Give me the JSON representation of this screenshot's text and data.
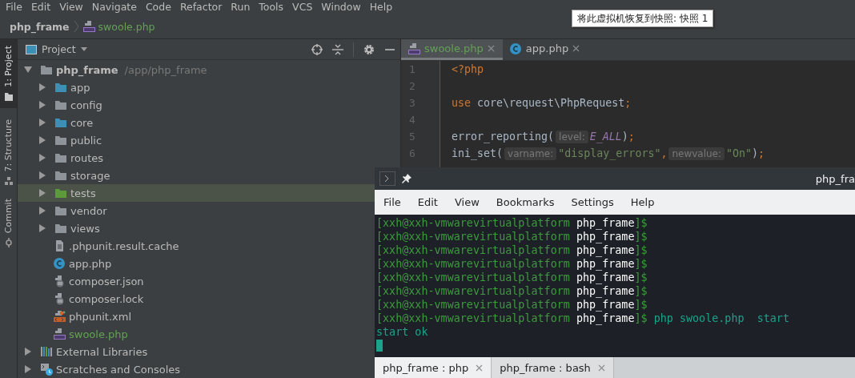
{
  "menu_bar": [
    "File",
    "Edit",
    "View",
    "Navigate",
    "Code",
    "Refactor",
    "Run",
    "Tools",
    "VCS",
    "Window",
    "Help"
  ],
  "breadcrumb": {
    "project": "php_frame",
    "file": "swoole.php"
  },
  "tooltip": "将此虚拟机恢复到快照: 快照 1",
  "tool_stripe": [
    {
      "label": "1: Project",
      "kind": "project",
      "selected": true
    },
    {
      "label": "7: Structure",
      "kind": "structure",
      "selected": false
    },
    {
      "label": "Commit",
      "kind": "commit",
      "selected": false
    }
  ],
  "project_panel": {
    "title": "Project",
    "tree": [
      {
        "name": "php_frame",
        "path": "/app/php_frame",
        "kind": "folder",
        "color": "#8e9499",
        "expanded": true,
        "selected": false,
        "added": false,
        "children": [
          {
            "name": "app",
            "kind": "folder",
            "color": "#3d8fb5",
            "expanded": false,
            "selected": false,
            "added": false
          },
          {
            "name": "config",
            "kind": "folder",
            "color": "#8e9499",
            "expanded": false,
            "selected": false,
            "added": false
          },
          {
            "name": "core",
            "kind": "folder",
            "color": "#3d8fb5",
            "expanded": false,
            "selected": false,
            "added": false
          },
          {
            "name": "public",
            "kind": "folder",
            "color": "#8e9499",
            "expanded": false,
            "selected": false,
            "added": false
          },
          {
            "name": "routes",
            "kind": "folder",
            "color": "#8e9499",
            "expanded": false,
            "selected": false,
            "added": false
          },
          {
            "name": "storage",
            "kind": "folder",
            "color": "#8e9499",
            "expanded": false,
            "selected": false,
            "added": false
          },
          {
            "name": "tests",
            "kind": "folder",
            "color": "#5d9a3c",
            "expanded": false,
            "selected": true,
            "added": false
          },
          {
            "name": "vendor",
            "kind": "folder",
            "color": "#8e9499",
            "expanded": false,
            "selected": false,
            "added": false
          },
          {
            "name": "views",
            "kind": "folder",
            "color": "#8e9499",
            "expanded": false,
            "selected": false,
            "added": false
          },
          {
            "name": ".phpunit.result.cache",
            "kind": "text-file",
            "selected": false,
            "added": false
          },
          {
            "name": "app.php",
            "kind": "class-file",
            "selected": false,
            "added": false
          },
          {
            "name": "composer.json",
            "kind": "composer-file",
            "selected": false,
            "added": false
          },
          {
            "name": "composer.lock",
            "kind": "composer-file",
            "selected": false,
            "added": false
          },
          {
            "name": "phpunit.xml",
            "kind": "xml-file",
            "selected": false,
            "added": false
          },
          {
            "name": "swoole.php",
            "kind": "php-file",
            "selected": false,
            "added": true
          }
        ]
      },
      {
        "name": "External Libraries",
        "kind": "libraries",
        "expanded": false,
        "selected": false,
        "added": false
      },
      {
        "name": "Scratches and Consoles",
        "kind": "scratches",
        "expanded": false,
        "selected": false,
        "added": false
      }
    ]
  },
  "editor": {
    "tabs": [
      {
        "label": "swoole.php",
        "kind": "php-file",
        "selected": true,
        "added": true
      },
      {
        "label": "app.php",
        "kind": "class-file",
        "selected": false,
        "added": false
      }
    ],
    "lines": [
      {
        "number": "1",
        "tokens": [
          {
            "kind": "keyword",
            "text": "<?php"
          }
        ]
      },
      {
        "number": "2"
      },
      {
        "number": "3",
        "tokens": [
          {
            "kind": "keyword",
            "text": "use"
          },
          {
            "kind": "plain",
            "text": " core\\request\\PhpRequest"
          },
          {
            "kind": "keyword",
            "text": ";"
          }
        ]
      },
      {
        "number": "4"
      },
      {
        "number": "5",
        "tokens": [
          {
            "kind": "plain",
            "text": "error_reporting("
          },
          {
            "kind": "hint",
            "text": "level:"
          },
          {
            "kind": "constant",
            "text": "E_ALL"
          },
          {
            "kind": "plain",
            "text": ")"
          },
          {
            "kind": "keyword",
            "text": ";"
          }
        ]
      },
      {
        "number": "6",
        "tokens": [
          {
            "kind": "plain",
            "text": "ini_set("
          },
          {
            "kind": "hint",
            "text": "varname:"
          },
          {
            "kind": "string",
            "text": "\"display_errors\""
          },
          {
            "kind": "keyword",
            "text": ","
          },
          {
            "kind": "hint",
            "text": "newvalue:"
          },
          {
            "kind": "string",
            "text": "\"On\""
          },
          {
            "kind": "plain",
            "text": ")"
          },
          {
            "kind": "keyword",
            "text": ";"
          }
        ]
      }
    ]
  },
  "terminal": {
    "title": "php_fra",
    "menu": [
      "File",
      "Edit",
      "View",
      "Bookmarks",
      "Settings",
      "Help"
    ],
    "lines": [
      {
        "kind": "prompt",
        "user": "[xxh@xxh-vmwarevirtualplatform",
        "dir": "php_frame",
        "end": "]$"
      },
      {
        "kind": "prompt",
        "user": "[xxh@xxh-vmwarevirtualplatform",
        "dir": "php_frame",
        "end": "]$"
      },
      {
        "kind": "prompt",
        "user": "[xxh@xxh-vmwarevirtualplatform",
        "dir": "php_frame",
        "end": "]$"
      },
      {
        "kind": "prompt",
        "user": "[xxh@xxh-vmwarevirtualplatform",
        "dir": "php_frame",
        "end": "]$"
      },
      {
        "kind": "prompt",
        "user": "[xxh@xxh-vmwarevirtualplatform",
        "dir": "php_frame",
        "end": "]$"
      },
      {
        "kind": "prompt",
        "user": "[xxh@xxh-vmwarevirtualplatform",
        "dir": "php_frame",
        "end": "]$"
      },
      {
        "kind": "prompt",
        "user": "[xxh@xxh-vmwarevirtualplatform",
        "dir": "php_frame",
        "end": "]$"
      },
      {
        "kind": "prompt",
        "user": "[xxh@xxh-vmwarevirtualplatform",
        "dir": "php_frame",
        "end": "]$",
        "command": "php swoole.php  start"
      },
      {
        "kind": "output",
        "text": "start ok"
      },
      {
        "kind": "cursor"
      }
    ],
    "tabs": [
      {
        "label": "php_frame : php",
        "selected": true
      },
      {
        "label": "php_frame : bash",
        "selected": false
      }
    ]
  }
}
